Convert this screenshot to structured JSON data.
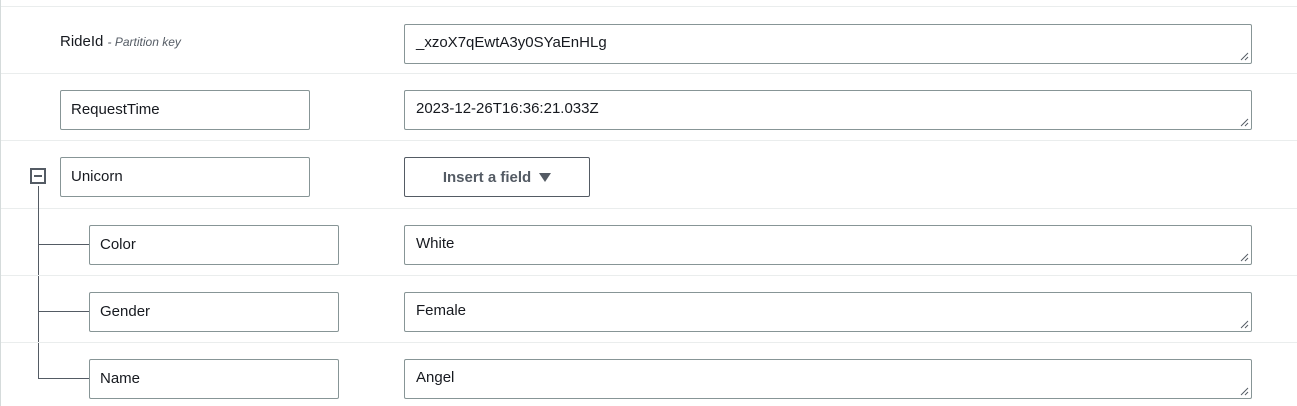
{
  "fields": {
    "rideid": {
      "key": "RideId",
      "hint": "- Partition key",
      "value": "_xzoX7qEwtA3y0SYaEnHLg"
    },
    "requesttime": {
      "key": "RequestTime",
      "value": "2023-12-26T16:36:21.033Z"
    },
    "unicorn": {
      "key": "Unicorn",
      "insert_label": "Insert a field",
      "children": {
        "color": {
          "key": "Color",
          "value": "White"
        },
        "gender": {
          "key": "Gender",
          "value": "Female"
        },
        "name": {
          "key": "Name",
          "value": "Angel"
        }
      }
    }
  },
  "icons": {
    "collapse": "minus-square-icon",
    "dropdown": "caret-down-icon",
    "resize": "resize-grip-icon"
  }
}
